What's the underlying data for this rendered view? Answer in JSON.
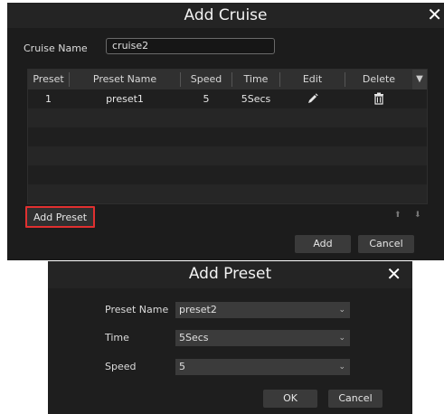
{
  "cruise_dialog": {
    "title": "Add Cruise",
    "close_icon": "close-icon",
    "cruise_name_label": "Cruise Name",
    "cruise_name_value": "cruise2",
    "table": {
      "headers": [
        "Preset",
        "Preset Name",
        "Speed",
        "Time",
        "Edit",
        "Delete"
      ],
      "rows": [
        {
          "preset": "1",
          "preset_name": "preset1",
          "speed": "5",
          "time": "5Secs",
          "edit_icon": "pencil-icon",
          "delete_icon": "trash-icon"
        }
      ]
    },
    "add_preset_label": "Add Preset",
    "add_label": "Add",
    "cancel_label": "Cancel",
    "highlight_color": "#e03030"
  },
  "preset_dialog": {
    "title": "Add Preset",
    "close_icon": "close-icon",
    "preset_name_label": "Preset Name",
    "preset_name_value": "preset2",
    "time_label": "Time",
    "time_value": "5Secs",
    "speed_label": "Speed",
    "speed_value": "5",
    "ok_label": "OK",
    "cancel_label": "Cancel"
  }
}
